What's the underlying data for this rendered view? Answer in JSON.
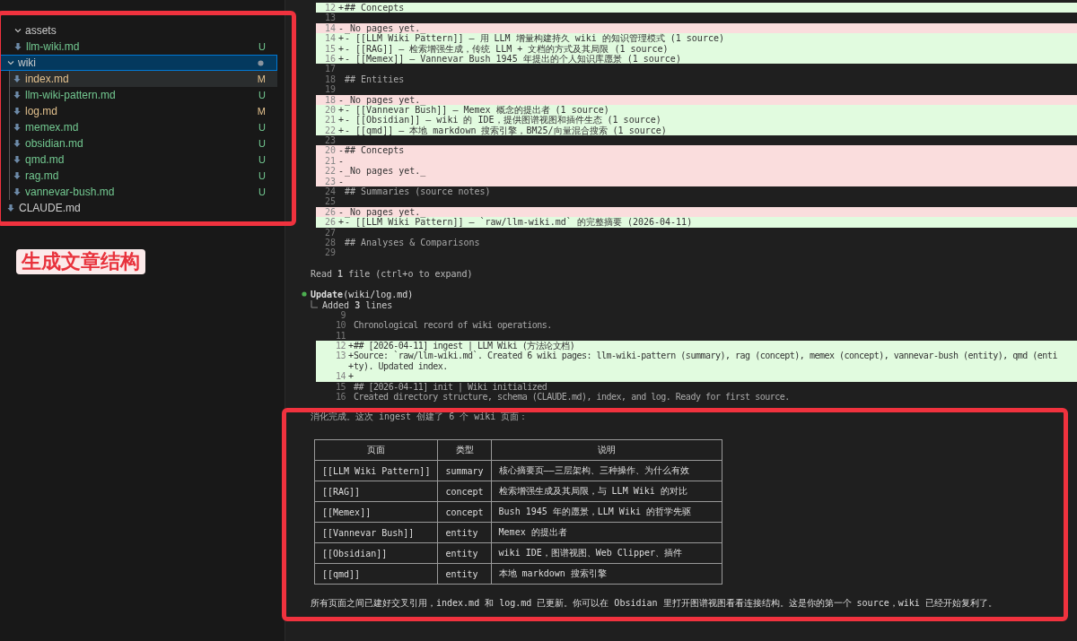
{
  "explorer": {
    "upper_items": [
      {
        "kind": "folder",
        "name": "assets",
        "expanded": true,
        "selected": false,
        "highlighted": false
      },
      {
        "kind": "file",
        "name": "llm-wiki.md",
        "selected": false,
        "highlighted": false,
        "status": "U"
      }
    ],
    "tree": [
      {
        "kind": "folder",
        "name": "wiki",
        "expanded": true,
        "selected": true,
        "highlighted": false,
        "modified": true,
        "children": [
          {
            "kind": "file",
            "name": "index.md",
            "selected": false,
            "highlighted": true,
            "status": "M"
          },
          {
            "kind": "file",
            "name": "llm-wiki-pattern.md",
            "selected": false,
            "highlighted": false,
            "status": "U"
          },
          {
            "kind": "file",
            "name": "log.md",
            "selected": false,
            "highlighted": false,
            "status": "M"
          },
          {
            "kind": "file",
            "name": "memex.md",
            "selected": false,
            "highlighted": false,
            "status": "U"
          },
          {
            "kind": "file",
            "name": "obsidian.md",
            "selected": false,
            "highlighted": false,
            "status": "U"
          },
          {
            "kind": "file",
            "name": "qmd.md",
            "selected": false,
            "highlighted": false,
            "status": "U"
          },
          {
            "kind": "file",
            "name": "rag.md",
            "selected": false,
            "highlighted": false,
            "status": "U"
          },
          {
            "kind": "file",
            "name": "vannevar-bush.md",
            "selected": false,
            "highlighted": false,
            "status": "U"
          }
        ]
      },
      {
        "kind": "file",
        "name": "CLAUDE.md",
        "selected": false,
        "highlighted": false
      }
    ]
  },
  "annotation_label": "生成文章结构",
  "index_diff": [
    {
      "num": "12",
      "kind": "add",
      "sign": "+",
      "text": "## Concepts"
    },
    {
      "num": "13",
      "kind": "context"
    },
    {
      "num": "14",
      "kind": "del",
      "sign": "-",
      "text": "_No pages yet._"
    },
    {
      "num": "14",
      "kind": "add",
      "sign": "+",
      "text": "- [[LLM Wiki Pattern]] — 用 LLM 增量构建持久 wiki 的知识管理模式 (1 source)"
    },
    {
      "num": "15",
      "kind": "add",
      "sign": "+",
      "text": "- [[RAG]] — 检索增强生成，传统 LLM + 文档的方式及其局限 (1 source)"
    },
    {
      "num": "16",
      "kind": "add",
      "sign": "+",
      "text": "- [[Memex]] — Vannevar Bush 1945 年提出的个人知识库愿景 (1 source)"
    },
    {
      "num": "17",
      "kind": "context"
    },
    {
      "num": "18",
      "kind": "context",
      "text": "## Entities"
    },
    {
      "num": "19",
      "kind": "context"
    },
    {
      "num": "18",
      "kind": "del",
      "sign": "-",
      "text": "_No pages yet._"
    },
    {
      "num": "20",
      "kind": "add",
      "sign": "+",
      "text": "- [[Vannevar Bush]] — Memex 概念的提出者 (1 source)"
    },
    {
      "num": "21",
      "kind": "add",
      "sign": "+",
      "text": "- [[Obsidian]] — wiki 的 IDE，提供图谱视图和插件生态 (1 source)"
    },
    {
      "num": "22",
      "kind": "add",
      "sign": "+",
      "text": "- [[qmd]] — 本地 markdown 搜索引擎，BM25/向量混合搜索 (1 source)"
    },
    {
      "num": "23",
      "kind": "context"
    },
    {
      "num": "20",
      "kind": "del",
      "sign": "-",
      "text": "## Concepts"
    },
    {
      "num": "21",
      "kind": "del",
      "sign": "-"
    },
    {
      "num": "22",
      "kind": "del",
      "sign": "-",
      "text": "_No pages yet._"
    },
    {
      "num": "23",
      "kind": "del",
      "sign": "-"
    },
    {
      "num": "24",
      "kind": "context",
      "text": "## Summaries (source notes)"
    },
    {
      "num": "25",
      "kind": "context"
    },
    {
      "num": "26",
      "kind": "del",
      "sign": "-",
      "text": "_No pages yet._"
    },
    {
      "num": "26",
      "kind": "add",
      "sign": "+",
      "text": "- [[LLM Wiki Pattern]] — `raw/llm-wiki.md` 的完整摘要 (2026-04-11)"
    },
    {
      "num": "27",
      "kind": "context"
    },
    {
      "num": "28",
      "kind": "context",
      "text": "## Analyses & Comparisons"
    },
    {
      "num": "29",
      "kind": "context"
    }
  ],
  "read_note": "Read **1** file (ctrl+o to expand)",
  "update": {
    "title": "**Update**(wiki/log.md)",
    "summary": "Added **3** lines"
  },
  "log_diff": [
    {
      "num": "9",
      "kind": "context"
    },
    {
      "num": "10",
      "kind": "context",
      "text": "Chronological record of wiki operations."
    },
    {
      "num": "11",
      "kind": "context"
    },
    {
      "num": "12",
      "kind": "add",
      "sign": "+",
      "text": "## [2026-04-11] ingest | LLM Wiki (方法论文档)"
    },
    {
      "num": "13",
      "kind": "add",
      "sign": "+",
      "text": "Source: `raw/llm-wiki.md`. Created 6 wiki pages: llm-wiki-pattern (summary), rag (concept), memex (concept), vannevar-bush (entity), qmd (enti"
    },
    {
      "kind": "add",
      "sign": "+",
      "text": "ty). Updated index."
    },
    {
      "num": "14",
      "kind": "add",
      "sign": "+"
    },
    {
      "num": "15",
      "kind": "context",
      "text": "## [2026-04-11] init | Wiki initialized"
    },
    {
      "num": "16",
      "kind": "context",
      "text": "Created directory structure, schema (CLAUDE.md), index, and log. Ready for first source."
    }
  ],
  "summary_heading": "消化完成。这次 ingest 创建了 6 个 wiki 页面：",
  "table": {
    "columns": [
      "页面",
      "类型",
      "说明"
    ],
    "rows": [
      [
        "[[LLM Wiki Pattern]]",
        "summary",
        "核心摘要页——三层架构、三种操作、为什么有效"
      ],
      [
        "[[RAG]]",
        "concept",
        "检索增强生成及其局限，与 LLM Wiki 的对比"
      ],
      [
        "[[Memex]]",
        "concept",
        "Bush 1945 年的愿景，LLM Wiki 的哲学先驱"
      ],
      [
        "[[Vannevar Bush]]",
        "entity",
        "Memex 的提出者"
      ],
      [
        "[[Obsidian]]",
        "entity",
        "wiki IDE，图谱视图、Web Clipper、插件"
      ],
      [
        "[[qmd]]",
        "entity",
        "本地 markdown 搜索引擎"
      ]
    ]
  },
  "closing_note": "所有页面之间已建好交叉引用，index.md 和 log.md 已更新。你可以在 Obsidian 里打开图谱视图看看连接结构。这是你的第一个 source，wiki 已经开始复利了。"
}
